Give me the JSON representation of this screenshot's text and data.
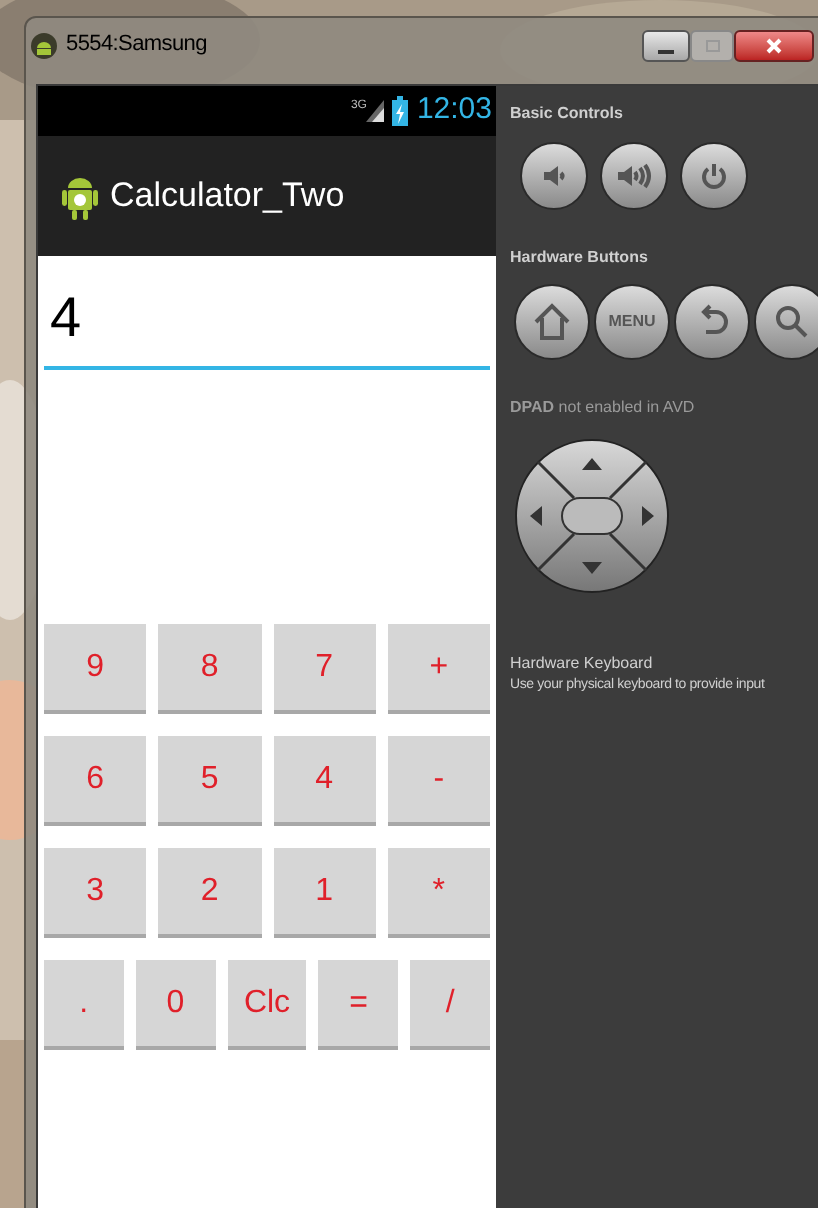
{
  "window": {
    "title": "5554:Samsung"
  },
  "status_bar": {
    "network": "3G",
    "time": "12:03"
  },
  "app_bar": {
    "title": "Calculator_Two"
  },
  "display": {
    "value": "4"
  },
  "keypad": {
    "rows": [
      [
        "9",
        "8",
        "7",
        "+"
      ],
      [
        "6",
        "5",
        "4",
        "-"
      ],
      [
        "3",
        "2",
        "1",
        "*"
      ],
      [
        ".",
        "0",
        "Clc",
        "=",
        "/"
      ]
    ]
  },
  "controls_panel": {
    "basic_controls": {
      "title": "Basic Controls",
      "buttons": [
        {
          "kind": "volume_down"
        },
        {
          "kind": "volume_up"
        },
        {
          "kind": "power"
        }
      ]
    },
    "hardware_buttons": {
      "title": "Hardware Buttons",
      "buttons": [
        {
          "kind": "home"
        },
        {
          "kind": "menu",
          "label": "MENU"
        },
        {
          "kind": "back"
        },
        {
          "kind": "search"
        }
      ]
    },
    "dpad": {
      "title": "**DPAD** not enabled in AVD"
    },
    "keyboard": {
      "title": "Hardware Keyboard",
      "hint": "Use your physical keyboard to provide input"
    }
  }
}
